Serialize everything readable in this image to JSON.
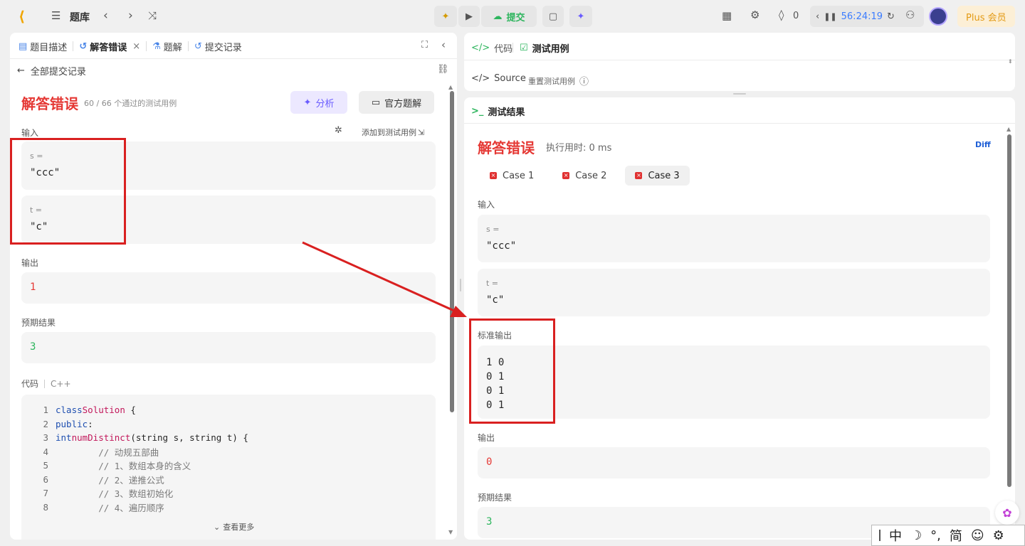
{
  "topbar": {
    "problem_bank": "题库",
    "submit": "提交",
    "streak": "0",
    "timer": "56:24:19",
    "plus": "Plus 会员"
  },
  "left": {
    "tabs": [
      "题目描述",
      "解答错误",
      "题解",
      "提交记录"
    ],
    "back": "全部提交记录",
    "status": "解答错误",
    "status_detail": "60 / 66 个通过的测试用例",
    "analyze": "分析",
    "official": "官方题解",
    "input_label": "输入",
    "add_case": "添加到测试用例",
    "s_label": "s =",
    "s_value": "\"ccc\"",
    "t_label": "t =",
    "t_value": "\"c\"",
    "output_label": "输出",
    "output_value": "1",
    "expected_label": "预期结果",
    "expected_value": "3",
    "code_label": "代码",
    "lang": "C++",
    "see_more": "查看更多",
    "code_lines": [
      "1",
      "2",
      "3",
      "4",
      "5",
      "6",
      "7",
      "8"
    ]
  },
  "right": {
    "code_tab": "代码",
    "testcase_tab": "测试用例",
    "source": "Source",
    "reset": "重置测试用例",
    "result_title": "测试结果",
    "status": "解答错误",
    "runtime": "执行用时: 0 ms",
    "diff": "Diff",
    "cases": [
      "Case 1",
      "Case 2",
      "Case 3"
    ],
    "input_label": "输入",
    "s_label": "s =",
    "s_value": "\"ccc\"",
    "t_label": "t =",
    "t_value": "\"c\"",
    "stdout_label": "标准输出",
    "stdout_lines": [
      "1 0",
      "0 1",
      "0 1",
      "0 1"
    ],
    "output_label": "输出",
    "output_value": "0",
    "expected_label": "预期结果",
    "expected_value": "3"
  },
  "ime": {
    "items": [
      "中",
      "简"
    ]
  },
  "colors": {
    "error_red": "#e53935",
    "accent_green": "#2db55d",
    "plus_orange": "#e39a14",
    "annotation_red": "#d92020"
  }
}
